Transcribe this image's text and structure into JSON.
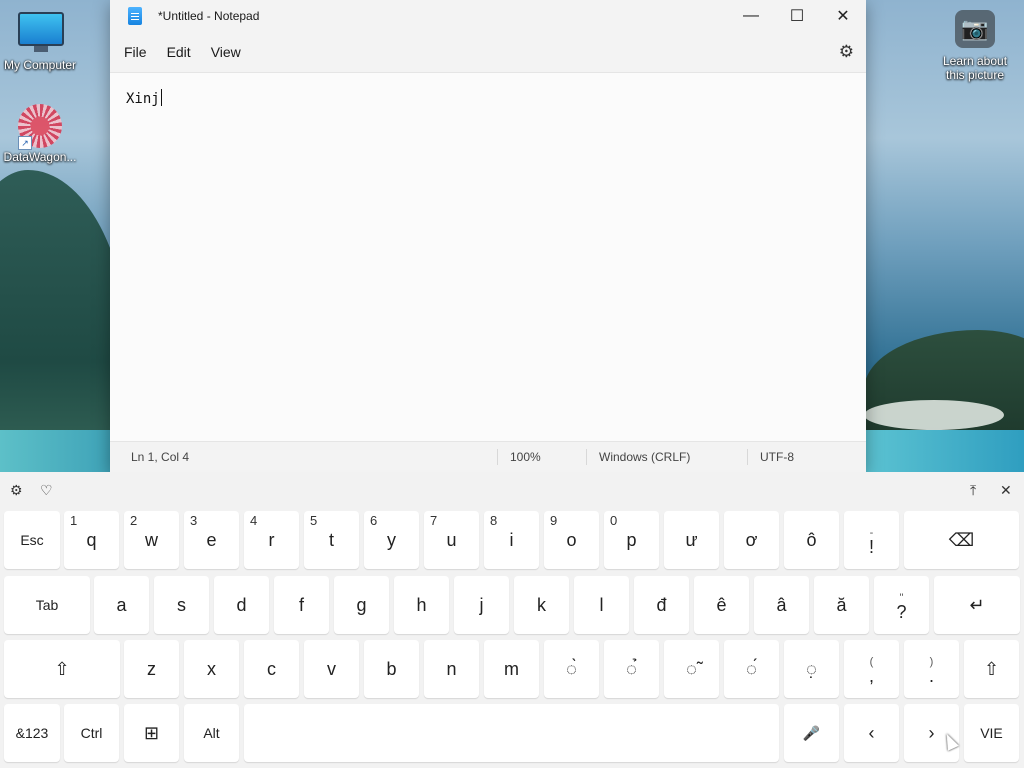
{
  "desktop": {
    "icons": [
      {
        "label": "My Computer",
        "icon": "monitor-icon"
      },
      {
        "label": "DataWagon...",
        "icon": "datawagon-icon"
      }
    ],
    "learn_label": "Learn about this picture",
    "learn_icon": "camera-icon"
  },
  "notepad": {
    "title": "*Untitled - Notepad",
    "controls": {
      "minimize": "—",
      "maximize": "☐",
      "close": "✕"
    },
    "menu": [
      "File",
      "Edit",
      "View"
    ],
    "settings_icon": "⚙",
    "content": "Xinj",
    "status": {
      "position": "Ln 1, Col 4",
      "zoom": "100%",
      "line_ending": "Windows (CRLF)",
      "encoding": "UTF-8"
    }
  },
  "keyboard": {
    "top_icons": {
      "settings": "⚙",
      "emoji": "♡",
      "dock": "⤒",
      "close": "✕"
    },
    "row1": [
      {
        "k": "Esc"
      },
      {
        "k": "q",
        "n": "1"
      },
      {
        "k": "w",
        "n": "2"
      },
      {
        "k": "e",
        "n": "3"
      },
      {
        "k": "r",
        "n": "4"
      },
      {
        "k": "t",
        "n": "5"
      },
      {
        "k": "y",
        "n": "6"
      },
      {
        "k": "u",
        "n": "7"
      },
      {
        "k": "i",
        "n": "8"
      },
      {
        "k": "o",
        "n": "9"
      },
      {
        "k": "p",
        "n": "0"
      },
      {
        "k": "ư"
      },
      {
        "k": "ơ"
      },
      {
        "k": "ô"
      },
      {
        "k": "!",
        "t": "-"
      },
      {
        "k": "⌫"
      }
    ],
    "row2": [
      {
        "k": "Tab"
      },
      {
        "k": "a"
      },
      {
        "k": "s"
      },
      {
        "k": "d"
      },
      {
        "k": "f"
      },
      {
        "k": "g"
      },
      {
        "k": "h"
      },
      {
        "k": "j"
      },
      {
        "k": "k"
      },
      {
        "k": "l"
      },
      {
        "k": "đ"
      },
      {
        "k": "ê"
      },
      {
        "k": "â"
      },
      {
        "k": "ă"
      },
      {
        "k": "?",
        "t": "\""
      },
      {
        "k": "↵"
      }
    ],
    "row3": [
      {
        "k": "⇧"
      },
      {
        "k": "z"
      },
      {
        "k": "x"
      },
      {
        "k": "c"
      },
      {
        "k": "v"
      },
      {
        "k": "b"
      },
      {
        "k": "n"
      },
      {
        "k": "m"
      },
      {
        "k": "◌̀"
      },
      {
        "k": "◌̉"
      },
      {
        "k": "◌̃"
      },
      {
        "k": "◌́"
      },
      {
        "k": "◌̣"
      },
      {
        "k": ",",
        "t": "("
      },
      {
        "k": ".",
        "t": ")"
      },
      {
        "k": "⇧"
      }
    ],
    "row4": [
      {
        "k": "&123"
      },
      {
        "k": "Ctrl"
      },
      {
        "k": "⊞"
      },
      {
        "k": "Alt"
      },
      {
        "k": ""
      },
      {
        "k": "🎤"
      },
      {
        "k": "‹"
      },
      {
        "k": "›"
      },
      {
        "k": "VIE"
      }
    ]
  }
}
